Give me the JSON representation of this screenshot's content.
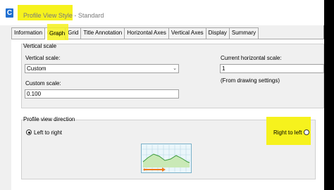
{
  "window": {
    "title_highlighted": "Profile View Style",
    "title_rest": " - Standard"
  },
  "tabs": [
    {
      "label": "Information"
    },
    {
      "label": "Graph"
    },
    {
      "label": "Grid"
    },
    {
      "label": "Title Annotation"
    },
    {
      "label": "Horizontal Axes"
    },
    {
      "label": "Vertical Axes"
    },
    {
      "label": "Display"
    },
    {
      "label": "Summary"
    }
  ],
  "vertical_scale": {
    "group_label": "Vertical scale",
    "scale_label": "Vertical scale:",
    "scale_value": "Custom",
    "custom_label": "Custom scale:",
    "custom_value": "0.100",
    "current_h_label": "Current horizontal scale:",
    "current_h_value": "1",
    "current_h_note": "(From drawing settings)"
  },
  "direction": {
    "group_label": "Profile view direction",
    "left_to_right": "Left to right",
    "right_to_left": "Right to left",
    "selected": "left_to_right"
  },
  "colors": {
    "highlight": "#f6f21d",
    "accent": "#1f6fd1"
  }
}
